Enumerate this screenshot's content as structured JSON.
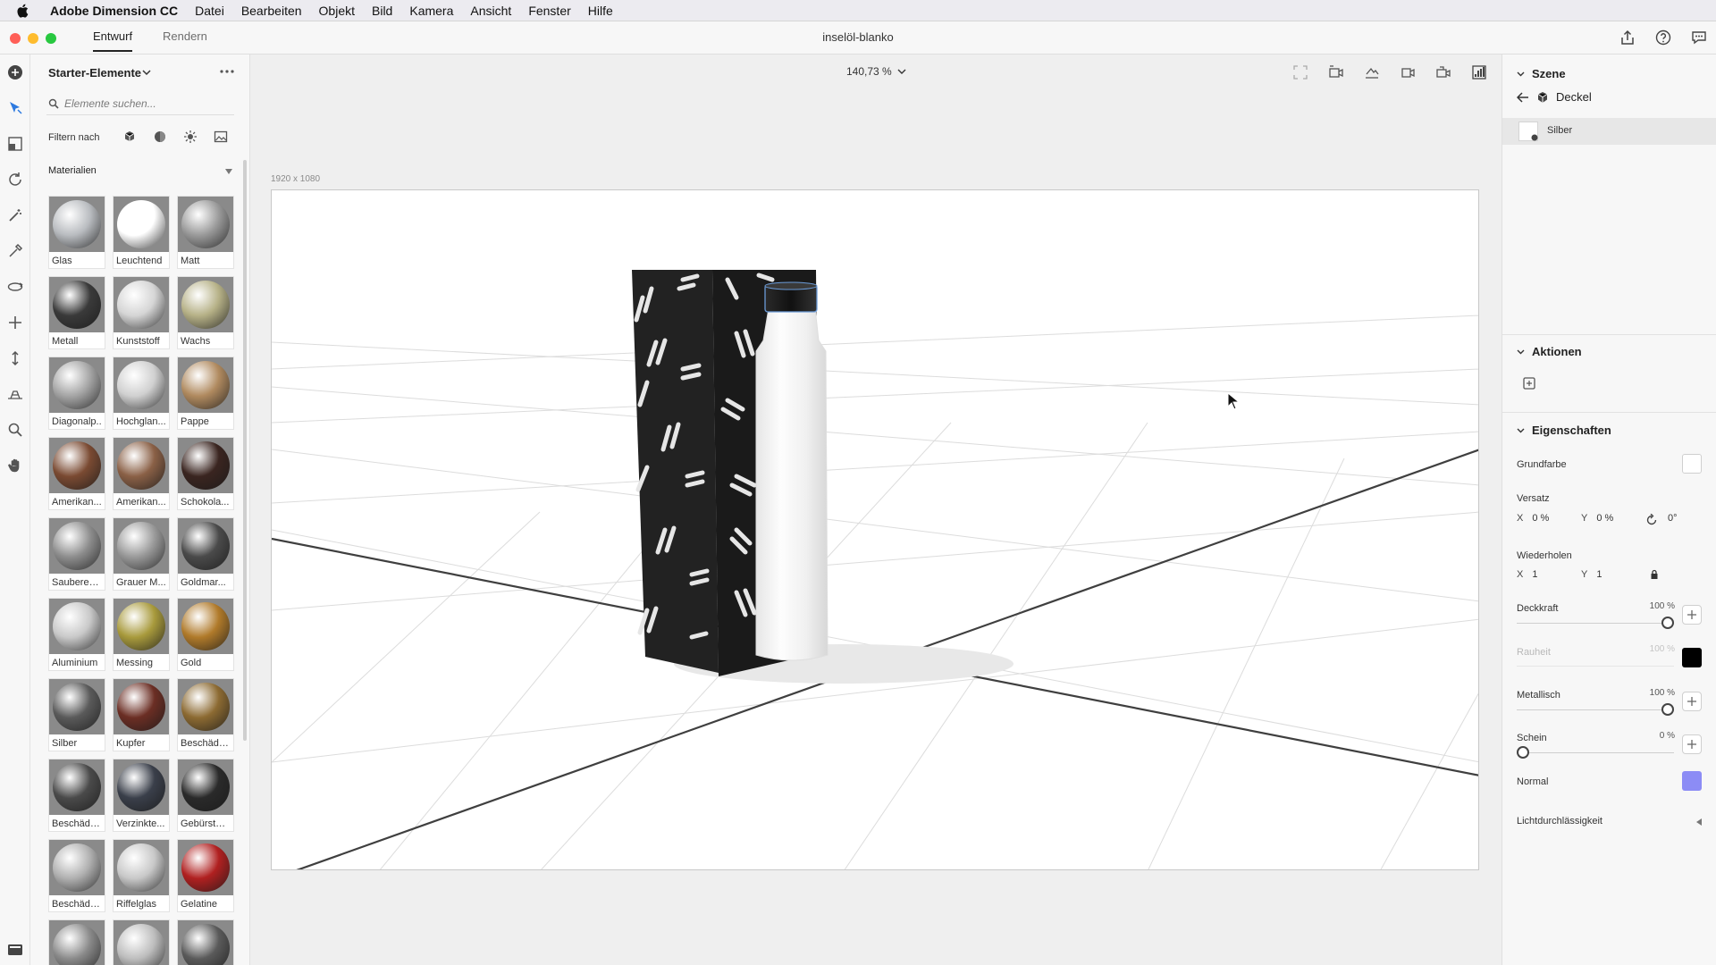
{
  "menubar": {
    "app": "Adobe Dimension CC",
    "items": [
      "Datei",
      "Bearbeiten",
      "Objekt",
      "Bild",
      "Kamera",
      "Ansicht",
      "Fenster",
      "Hilfe"
    ]
  },
  "titlebar": {
    "tabs": [
      {
        "label": "Entwurf",
        "active": true
      },
      {
        "label": "Rendern",
        "active": false
      }
    ],
    "document_title": "inselöl-blanko"
  },
  "assets": {
    "title": "Starter-Elemente",
    "search_placeholder": "Elemente suchen...",
    "filter_label": "Filtern nach",
    "section_label": "Materialien",
    "materials": [
      {
        "label": "Glas",
        "color": "#b9bcc0"
      },
      {
        "label": "Leuchtend",
        "color": "#ffffff"
      },
      {
        "label": "Matt",
        "color": "#9a9a9a"
      },
      {
        "label": "Metall",
        "color": "#3a3a3a"
      },
      {
        "label": "Kunststoff",
        "color": "#d5d5d5"
      },
      {
        "label": "Wachs",
        "color": "#b6b187"
      },
      {
        "label": "Diagonalp..",
        "color": "#a5a5a5"
      },
      {
        "label": "Hochglan...",
        "color": "#d0d0d0"
      },
      {
        "label": "Pappe",
        "color": "#b08a5f"
      },
      {
        "label": "Amerikan...",
        "color": "#7a4a32"
      },
      {
        "label": "Amerikan...",
        "color": "#8a6046"
      },
      {
        "label": "Schokola...",
        "color": "#3a2520"
      },
      {
        "label": "Sauberer ...",
        "color": "#8e8e8e"
      },
      {
        "label": "Grauer M...",
        "color": "#9a9a9a"
      },
      {
        "label": "Goldmar...",
        "color": "#4a4a4a"
      },
      {
        "label": "Aluminium",
        "color": "#c9c9c9"
      },
      {
        "label": "Messing",
        "color": "#a89a3c"
      },
      {
        "label": "Gold",
        "color": "#b07a2a"
      },
      {
        "label": "Silber",
        "color": "#5a5a5a"
      },
      {
        "label": "Kupfer",
        "color": "#6b2e24"
      },
      {
        "label": "Beschädig..",
        "color": "#8c6a32"
      },
      {
        "label": "Beschädig..",
        "color": "#4a4a4a"
      },
      {
        "label": "Verzinkte...",
        "color": "#3a3f4a"
      },
      {
        "label": "Gebürstet...",
        "color": "#2a2a2a"
      },
      {
        "label": "Beschädig..",
        "color": "#b0b0b0"
      },
      {
        "label": "Riffelglas",
        "color": "#c8c8c8"
      },
      {
        "label": "Gelatine",
        "color": "#b02020"
      },
      {
        "label": "",
        "color": "#8a8a8a"
      },
      {
        "label": "",
        "color": "#bdbdbd"
      },
      {
        "label": "",
        "color": "#5a5a5a"
      }
    ]
  },
  "canvas": {
    "zoom": "140,73 %",
    "size_label": "1920 x 1080"
  },
  "props": {
    "scene_title": "Szene",
    "selected_object": "Deckel",
    "material_name": "Silber",
    "actions_title": "Aktionen",
    "properties_title": "Eigenschaften",
    "grundfarbe": "Grundfarbe",
    "versatz": "Versatz",
    "versatz_x_key": "X",
    "versatz_x": "0 %",
    "versatz_y_key": "Y",
    "versatz_y": "0 %",
    "versatz_rot": "0°",
    "wiederholen": "Wiederholen",
    "wiederholen_x_key": "X",
    "wiederholen_x": "1",
    "wiederholen_y_key": "Y",
    "wiederholen_y": "1",
    "deckkraft": "Deckkraft",
    "deckkraft_value": "100 %",
    "deckkraft_level": 1.0,
    "rauheit": "Rauheit",
    "rauheit_value": "100 %",
    "metallisch": "Metallisch",
    "metallisch_value": "100 %",
    "metallisch_level": 1.0,
    "schein": "Schein",
    "schein_value": "0 %",
    "schein_level": 0.0,
    "normal": "Normal",
    "lichtdurchlaessigkeit": "Lichtdurchlässigkeit",
    "colors": {
      "grundfarbe": "#ffffff",
      "rauheit": "#000000",
      "normal": "#8c8cf5"
    }
  }
}
